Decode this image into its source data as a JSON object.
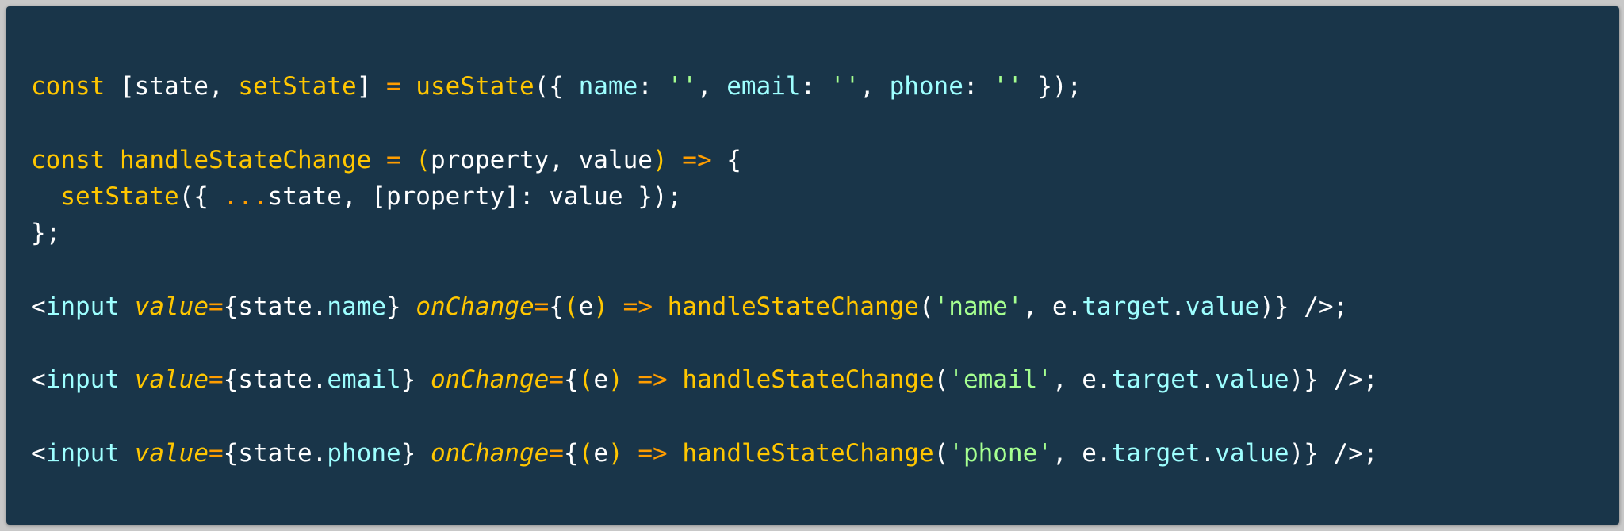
{
  "code": {
    "language": "javascript-jsx",
    "theme_colors": {
      "background": "#193549",
      "keyword": "#ffc600",
      "function": "#ffc600",
      "operator": "#ff9d00",
      "property": "#9effff",
      "string": "#a5ff90",
      "plain": "#ffffff"
    },
    "lines": [
      [
        {
          "t": "const",
          "c": "kw"
        },
        {
          "t": " [state, ",
          "c": "txt"
        },
        {
          "t": "setState",
          "c": "fn"
        },
        {
          "t": "] ",
          "c": "txt"
        },
        {
          "t": "=",
          "c": "op"
        },
        {
          "t": " ",
          "c": "txt"
        },
        {
          "t": "useState",
          "c": "fn"
        },
        {
          "t": "({ ",
          "c": "txt"
        },
        {
          "t": "name",
          "c": "prop"
        },
        {
          "t": ": ",
          "c": "txt"
        },
        {
          "t": "''",
          "c": "str"
        },
        {
          "t": ", ",
          "c": "txt"
        },
        {
          "t": "email",
          "c": "prop"
        },
        {
          "t": ": ",
          "c": "txt"
        },
        {
          "t": "''",
          "c": "str"
        },
        {
          "t": ", ",
          "c": "txt"
        },
        {
          "t": "phone",
          "c": "prop"
        },
        {
          "t": ": ",
          "c": "txt"
        },
        {
          "t": "''",
          "c": "str"
        },
        {
          "t": " });",
          "c": "txt"
        }
      ],
      [],
      [
        {
          "t": "const",
          "c": "kw"
        },
        {
          "t": " ",
          "c": "txt"
        },
        {
          "t": "handleStateChange",
          "c": "fn"
        },
        {
          "t": " ",
          "c": "txt"
        },
        {
          "t": "=",
          "c": "op"
        },
        {
          "t": " ",
          "c": "txt"
        },
        {
          "t": "(",
          "c": "kw"
        },
        {
          "t": "property, value",
          "c": "txt"
        },
        {
          "t": ")",
          "c": "kw"
        },
        {
          "t": " ",
          "c": "txt"
        },
        {
          "t": "=>",
          "c": "op"
        },
        {
          "t": " {",
          "c": "txt"
        }
      ],
      [
        {
          "t": "  ",
          "c": "txt"
        },
        {
          "t": "setState",
          "c": "fn"
        },
        {
          "t": "({ ",
          "c": "txt"
        },
        {
          "t": "...",
          "c": "op"
        },
        {
          "t": "state, [property]: value });",
          "c": "txt"
        }
      ],
      [
        {
          "t": "};",
          "c": "txt"
        }
      ],
      [],
      [
        {
          "t": "<",
          "c": "txt"
        },
        {
          "t": "input",
          "c": "tag"
        },
        {
          "t": " ",
          "c": "txt"
        },
        {
          "t": "value",
          "c": "attr"
        },
        {
          "t": "=",
          "c": "op"
        },
        {
          "t": "{state.",
          "c": "txt"
        },
        {
          "t": "name",
          "c": "prop"
        },
        {
          "t": "} ",
          "c": "txt"
        },
        {
          "t": "onChange",
          "c": "attr"
        },
        {
          "t": "=",
          "c": "op"
        },
        {
          "t": "{",
          "c": "txt"
        },
        {
          "t": "(",
          "c": "kw"
        },
        {
          "t": "e",
          "c": "txt"
        },
        {
          "t": ")",
          "c": "kw"
        },
        {
          "t": " ",
          "c": "txt"
        },
        {
          "t": "=>",
          "c": "op"
        },
        {
          "t": " ",
          "c": "txt"
        },
        {
          "t": "handleStateChange",
          "c": "fn"
        },
        {
          "t": "(",
          "c": "txt"
        },
        {
          "t": "'name'",
          "c": "str"
        },
        {
          "t": ", e.",
          "c": "txt"
        },
        {
          "t": "target",
          "c": "prop"
        },
        {
          "t": ".",
          "c": "txt"
        },
        {
          "t": "value",
          "c": "prop"
        },
        {
          "t": ")} />;",
          "c": "txt"
        }
      ],
      [],
      [
        {
          "t": "<",
          "c": "txt"
        },
        {
          "t": "input",
          "c": "tag"
        },
        {
          "t": " ",
          "c": "txt"
        },
        {
          "t": "value",
          "c": "attr"
        },
        {
          "t": "=",
          "c": "op"
        },
        {
          "t": "{state.",
          "c": "txt"
        },
        {
          "t": "email",
          "c": "prop"
        },
        {
          "t": "} ",
          "c": "txt"
        },
        {
          "t": "onChange",
          "c": "attr"
        },
        {
          "t": "=",
          "c": "op"
        },
        {
          "t": "{",
          "c": "txt"
        },
        {
          "t": "(",
          "c": "kw"
        },
        {
          "t": "e",
          "c": "txt"
        },
        {
          "t": ")",
          "c": "kw"
        },
        {
          "t": " ",
          "c": "txt"
        },
        {
          "t": "=>",
          "c": "op"
        },
        {
          "t": " ",
          "c": "txt"
        },
        {
          "t": "handleStateChange",
          "c": "fn"
        },
        {
          "t": "(",
          "c": "txt"
        },
        {
          "t": "'email'",
          "c": "str"
        },
        {
          "t": ", e.",
          "c": "txt"
        },
        {
          "t": "target",
          "c": "prop"
        },
        {
          "t": ".",
          "c": "txt"
        },
        {
          "t": "value",
          "c": "prop"
        },
        {
          "t": ")} />;",
          "c": "txt"
        }
      ],
      [],
      [
        {
          "t": "<",
          "c": "txt"
        },
        {
          "t": "input",
          "c": "tag"
        },
        {
          "t": " ",
          "c": "txt"
        },
        {
          "t": "value",
          "c": "attr"
        },
        {
          "t": "=",
          "c": "op"
        },
        {
          "t": "{state.",
          "c": "txt"
        },
        {
          "t": "phone",
          "c": "prop"
        },
        {
          "t": "} ",
          "c": "txt"
        },
        {
          "t": "onChange",
          "c": "attr"
        },
        {
          "t": "=",
          "c": "op"
        },
        {
          "t": "{",
          "c": "txt"
        },
        {
          "t": "(",
          "c": "kw"
        },
        {
          "t": "e",
          "c": "txt"
        },
        {
          "t": ")",
          "c": "kw"
        },
        {
          "t": " ",
          "c": "txt"
        },
        {
          "t": "=>",
          "c": "op"
        },
        {
          "t": " ",
          "c": "txt"
        },
        {
          "t": "handleStateChange",
          "c": "fn"
        },
        {
          "t": "(",
          "c": "txt"
        },
        {
          "t": "'phone'",
          "c": "str"
        },
        {
          "t": ", e.",
          "c": "txt"
        },
        {
          "t": "target",
          "c": "prop"
        },
        {
          "t": ".",
          "c": "txt"
        },
        {
          "t": "value",
          "c": "prop"
        },
        {
          "t": ")} />;",
          "c": "txt"
        }
      ]
    ]
  }
}
